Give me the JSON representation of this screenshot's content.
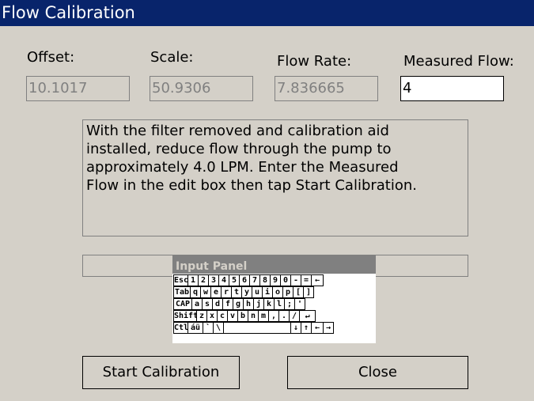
{
  "window": {
    "title": "Flow Calibration"
  },
  "fields": {
    "offset": {
      "label": "Offset:",
      "value": "10.1017"
    },
    "scale": {
      "label": "Scale:",
      "value": "50.9306"
    },
    "flow_rate": {
      "label": "Flow Rate:",
      "value": "7.836665"
    },
    "measured_flow": {
      "label": "Measured Flow:",
      "value": "4"
    }
  },
  "instructions": "With the filter removed and calibration aid\ninstalled, reduce flow through the pump to\napproximately  4.0 LPM.  Enter the Measured\nFlow in the edit box then tap Start Calibration.",
  "buttons": {
    "start": "Start Calibration",
    "close": "Close"
  },
  "input_panel": {
    "title": "Input Panel",
    "rows": [
      [
        "Esc",
        "1",
        "2",
        "3",
        "4",
        "5",
        "6",
        "7",
        "8",
        "9",
        "0",
        "-",
        "=",
        "←"
      ],
      [
        "Tab",
        "q",
        "w",
        "e",
        "r",
        "t",
        "y",
        "u",
        "i",
        "o",
        "p",
        "[",
        "]"
      ],
      [
        "CAP",
        "a",
        "s",
        "d",
        "f",
        "g",
        "h",
        "j",
        "k",
        "l",
        ";",
        "'"
      ],
      [
        "Shift",
        "z",
        "x",
        "c",
        "v",
        "b",
        "n",
        "m",
        ",",
        ".",
        "/",
        "↵"
      ],
      [
        "Ctl",
        "áü",
        "`",
        "\\",
        " ",
        "↓",
        "↑",
        "←",
        "→"
      ]
    ]
  }
}
